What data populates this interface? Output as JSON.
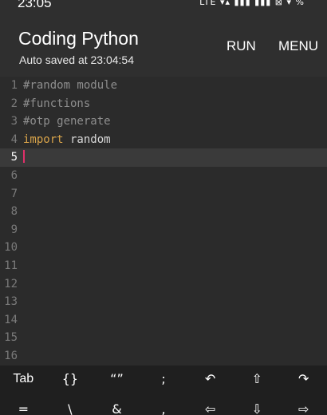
{
  "status_bar": {
    "time": "23:05",
    "icons": "LTE ▾▴  ▮▮▮  ▮▮▮  ⊠  ▾ %"
  },
  "app_bar": {
    "title": "Coding Python",
    "subtitle": "Auto saved at 23:04:54",
    "run_label": "RUN",
    "menu_label": "MENU"
  },
  "editor": {
    "active_line": 5,
    "lines": [
      {
        "num": "1",
        "comment": "#random module"
      },
      {
        "num": "2",
        "comment": "#functions"
      },
      {
        "num": "3",
        "comment": "#otp generate"
      },
      {
        "num": "4",
        "keyword": "import",
        "rest": " random"
      },
      {
        "num": "5"
      },
      {
        "num": "6"
      },
      {
        "num": "7"
      },
      {
        "num": "8"
      },
      {
        "num": "9"
      },
      {
        "num": "10"
      },
      {
        "num": "11"
      },
      {
        "num": "12"
      },
      {
        "num": "13"
      },
      {
        "num": "14"
      },
      {
        "num": "15"
      },
      {
        "num": "16"
      }
    ]
  },
  "keyboard_bar": {
    "row1": [
      "Tab",
      "{}",
      "“”",
      ";",
      "↶",
      "⇧",
      "↷"
    ],
    "row2": [
      "=",
      "\\",
      "&",
      ",",
      "⇦",
      "⇩",
      "⇨"
    ]
  },
  "colors": {
    "background": "#2b2b2b",
    "appbar": "#2f2f2f",
    "comment": "#8e8e8e",
    "keyword": "#d9a44a",
    "cursor": "#e0306a"
  }
}
